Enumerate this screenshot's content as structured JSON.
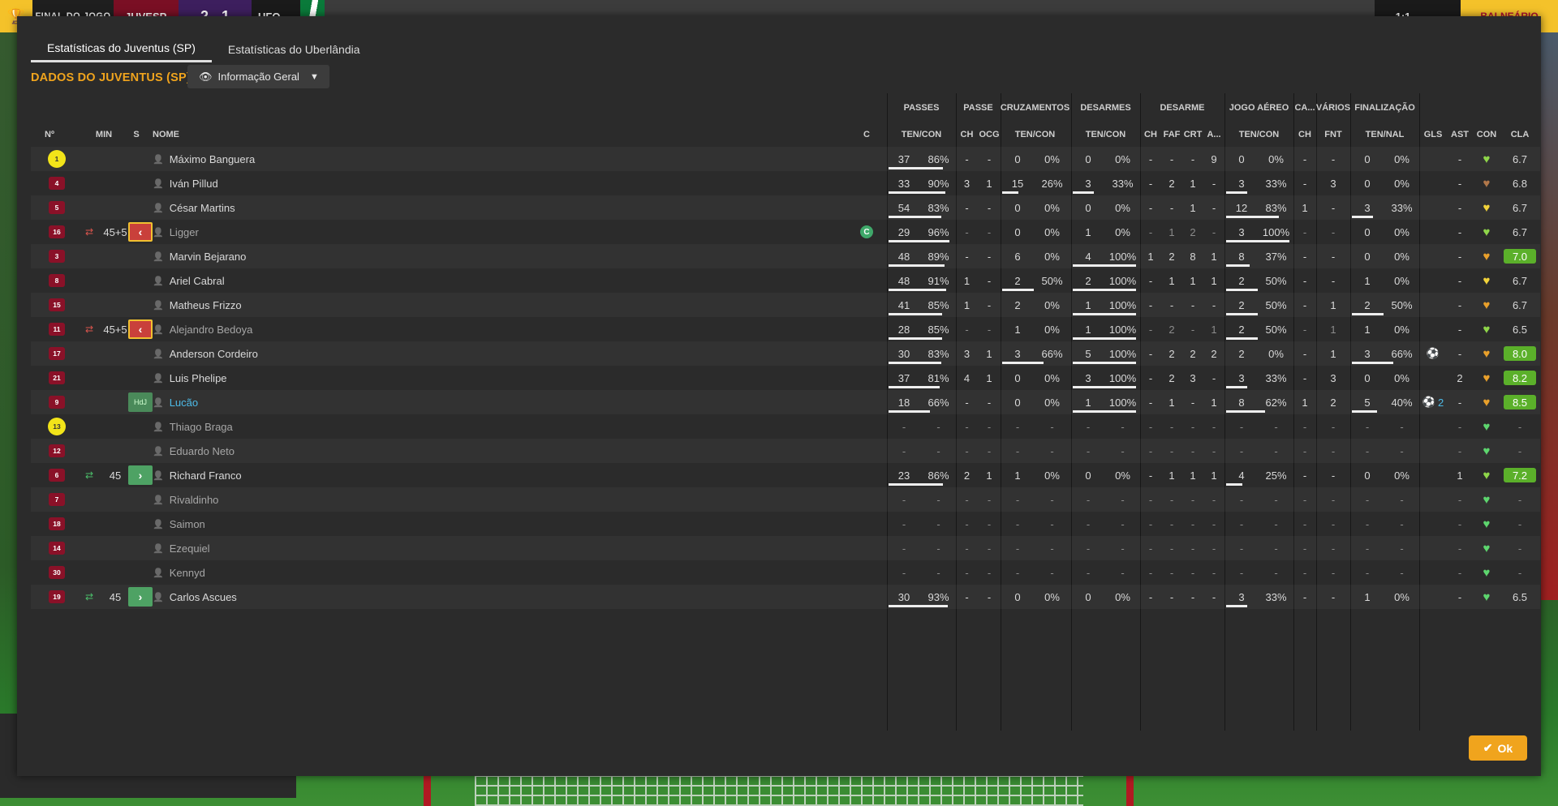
{
  "topbar": {
    "result_label": "FINAL DO JOGO",
    "home_team": "JUVESP",
    "score": "2 - 1",
    "away_team": "UFO",
    "clock": "1:1",
    "right_button": "BALNEÁRIO"
  },
  "dialog": {
    "tabs": [
      "Estatísticas do Juventus (SP)",
      "Estatísticas do Uberlândia"
    ],
    "heading": "DADOS DO JUVENTUS (SP)",
    "view_select": "Informação Geral",
    "ok_label": "Ok"
  },
  "groups": [
    "PASSES",
    "PASSE",
    "CRUZAMENTOS",
    "DESARMES",
    "DESARME",
    "JOGO AÉREO",
    "CA...",
    "VÁRIOS",
    "FINALIZAÇÃO"
  ],
  "headers": [
    "Nº",
    "MIN",
    "S",
    "NOME",
    "C",
    "TEN/CON",
    "CH",
    "OCG",
    "TEN/CON",
    "TEN/CON",
    "CH",
    "FAF",
    "CRT",
    "A...",
    "TEN/CON",
    "CH",
    "FNT",
    "TEN/NAL",
    "GLS",
    "AST",
    "CON",
    "CLA"
  ],
  "colors": {
    "accent": "#f0a41d",
    "shirt": "#8a1128",
    "keeper_shirt": "#f2e419",
    "sub_out": "#c9403b",
    "sub_in": "#4ea264",
    "rating_high": "#5bb02a",
    "highlight_name": "#4dbbe8"
  },
  "players": [
    {
      "num": "1",
      "gk": true,
      "min": "",
      "sub": "",
      "name": "Máximo Banguera",
      "dim": false,
      "cap": false,
      "pass_att": "37",
      "pass_pct": "86%",
      "pass_frac": 0.86,
      "kp": "-",
      "ocg": "-",
      "cr_att": "0",
      "cr_pct": "0%",
      "cr_frac": 0,
      "tk_att": "0",
      "tk_pct": "0%",
      "tk_frac": 0,
      "d_ch": "-",
      "d_faf": "-",
      "d_crt": "-",
      "d_a": "9",
      "air_att": "0",
      "air_pct": "0%",
      "air_frac": 0,
      "ca_ch": "-",
      "fnt": "-",
      "sh_att": "0",
      "sh_pct": "0%",
      "sh_frac": 0,
      "gls": "",
      "ast": "-",
      "con": "lime",
      "cla": "6.7",
      "cla_hi": false
    },
    {
      "num": "4",
      "gk": false,
      "min": "",
      "sub": "",
      "name": "Iván Pillud",
      "dim": false,
      "cap": false,
      "pass_att": "33",
      "pass_pct": "90%",
      "pass_frac": 0.9,
      "kp": "3",
      "ocg": "1",
      "cr_att": "15",
      "cr_pct": "26%",
      "cr_frac": 0.26,
      "tk_att": "3",
      "tk_pct": "33%",
      "tk_frac": 0.33,
      "d_ch": "-",
      "d_faf": "2",
      "d_crt": "1",
      "d_a": "-",
      "air_att": "3",
      "air_pct": "33%",
      "air_frac": 0.33,
      "ca_ch": "-",
      "fnt": "3",
      "sh_att": "0",
      "sh_pct": "0%",
      "sh_frac": 0,
      "gls": "",
      "ast": "-",
      "con": "brown",
      "cla": "6.8",
      "cla_hi": false
    },
    {
      "num": "5",
      "gk": false,
      "min": "",
      "sub": "",
      "name": "César Martins",
      "dim": false,
      "cap": false,
      "pass_att": "54",
      "pass_pct": "83%",
      "pass_frac": 0.83,
      "kp": "-",
      "ocg": "-",
      "cr_att": "0",
      "cr_pct": "0%",
      "cr_frac": 0,
      "tk_att": "0",
      "tk_pct": "0%",
      "tk_frac": 0,
      "d_ch": "-",
      "d_faf": "-",
      "d_crt": "1",
      "d_a": "-",
      "air_att": "12",
      "air_pct": "83%",
      "air_frac": 0.83,
      "ca_ch": "1",
      "fnt": "-",
      "sh_att": "3",
      "sh_pct": "33%",
      "sh_frac": 0.33,
      "gls": "",
      "ast": "-",
      "con": "yellow",
      "cla": "6.7",
      "cla_hi": false
    },
    {
      "num": "16",
      "gk": false,
      "min": "45+5",
      "sub": "out",
      "name": "Ligger",
      "dim": true,
      "cap": true,
      "pass_att": "29",
      "pass_pct": "96%",
      "pass_frac": 0.96,
      "kp": "-",
      "ocg": "-",
      "cr_att": "0",
      "cr_pct": "0%",
      "cr_frac": 0,
      "tk_att": "1",
      "tk_pct": "0%",
      "tk_frac": 0,
      "d_ch": "-",
      "d_faf": "1",
      "d_crt": "2",
      "d_a": "-",
      "air_att": "3",
      "air_pct": "100%",
      "air_frac": 1,
      "ca_ch": "-",
      "fnt": "-",
      "sh_att": "0",
      "sh_pct": "0%",
      "sh_frac": 0,
      "gls": "",
      "ast": "-",
      "con": "lime",
      "cla": "6.7",
      "cla_hi": false
    },
    {
      "num": "3",
      "gk": false,
      "min": "",
      "sub": "",
      "name": "Marvin Bejarano",
      "dim": false,
      "cap": false,
      "pass_att": "48",
      "pass_pct": "89%",
      "pass_frac": 0.89,
      "kp": "-",
      "ocg": "-",
      "cr_att": "6",
      "cr_pct": "0%",
      "cr_frac": 0,
      "tk_att": "4",
      "tk_pct": "100%",
      "tk_frac": 1,
      "d_ch": "1",
      "d_faf": "2",
      "d_crt": "8",
      "d_a": "1",
      "air_att": "8",
      "air_pct": "37%",
      "air_frac": 0.37,
      "ca_ch": "-",
      "fnt": "-",
      "sh_att": "0",
      "sh_pct": "0%",
      "sh_frac": 0,
      "gls": "",
      "ast": "-",
      "con": "orange",
      "cla": "7.0",
      "cla_hi": true
    },
    {
      "num": "8",
      "gk": false,
      "min": "",
      "sub": "",
      "name": "Ariel Cabral",
      "dim": false,
      "cap": false,
      "pass_att": "48",
      "pass_pct": "91%",
      "pass_frac": 0.91,
      "kp": "1",
      "ocg": "-",
      "cr_att": "2",
      "cr_pct": "50%",
      "cr_frac": 0.5,
      "tk_att": "2",
      "tk_pct": "100%",
      "tk_frac": 1,
      "d_ch": "-",
      "d_faf": "1",
      "d_crt": "1",
      "d_a": "1",
      "air_att": "2",
      "air_pct": "50%",
      "air_frac": 0.5,
      "ca_ch": "-",
      "fnt": "-",
      "sh_att": "1",
      "sh_pct": "0%",
      "sh_frac": 0,
      "gls": "",
      "ast": "-",
      "con": "yellow",
      "cla": "6.7",
      "cla_hi": false
    },
    {
      "num": "15",
      "gk": false,
      "min": "",
      "sub": "",
      "name": "Matheus Frizzo",
      "dim": false,
      "cap": false,
      "pass_att": "41",
      "pass_pct": "85%",
      "pass_frac": 0.85,
      "kp": "1",
      "ocg": "-",
      "cr_att": "2",
      "cr_pct": "0%",
      "cr_frac": 0,
      "tk_att": "1",
      "tk_pct": "100%",
      "tk_frac": 1,
      "d_ch": "-",
      "d_faf": "-",
      "d_crt": "-",
      "d_a": "-",
      "air_att": "2",
      "air_pct": "50%",
      "air_frac": 0.5,
      "ca_ch": "-",
      "fnt": "1",
      "sh_att": "2",
      "sh_pct": "50%",
      "sh_frac": 0.5,
      "gls": "",
      "ast": "-",
      "con": "orange",
      "cla": "6.7",
      "cla_hi": false
    },
    {
      "num": "11",
      "gk": false,
      "min": "45+5",
      "sub": "out",
      "name": "Alejandro Bedoya",
      "dim": true,
      "cap": false,
      "pass_att": "28",
      "pass_pct": "85%",
      "pass_frac": 0.85,
      "kp": "-",
      "ocg": "-",
      "cr_att": "1",
      "cr_pct": "0%",
      "cr_frac": 0,
      "tk_att": "1",
      "tk_pct": "100%",
      "tk_frac": 1,
      "d_ch": "-",
      "d_faf": "2",
      "d_crt": "-",
      "d_a": "1",
      "air_att": "2",
      "air_pct": "50%",
      "air_frac": 0.5,
      "ca_ch": "-",
      "fnt": "1",
      "sh_att": "1",
      "sh_pct": "0%",
      "sh_frac": 0,
      "gls": "",
      "ast": "-",
      "con": "lime",
      "cla": "6.5",
      "cla_hi": false
    },
    {
      "num": "17",
      "gk": false,
      "min": "",
      "sub": "",
      "name": "Anderson Cordeiro",
      "dim": false,
      "cap": false,
      "pass_att": "30",
      "pass_pct": "83%",
      "pass_frac": 0.83,
      "kp": "3",
      "ocg": "1",
      "cr_att": "3",
      "cr_pct": "66%",
      "cr_frac": 0.66,
      "tk_att": "5",
      "tk_pct": "100%",
      "tk_frac": 1,
      "d_ch": "-",
      "d_faf": "2",
      "d_crt": "2",
      "d_a": "2",
      "air_att": "2",
      "air_pct": "0%",
      "air_frac": 0,
      "ca_ch": "-",
      "fnt": "1",
      "sh_att": "3",
      "sh_pct": "66%",
      "sh_frac": 0.66,
      "gls": "ball",
      "ast": "-",
      "con": "orange",
      "cla": "8.0",
      "cla_hi": true
    },
    {
      "num": "21",
      "gk": false,
      "min": "",
      "sub": "",
      "name": "Luis Phelipe",
      "dim": false,
      "cap": false,
      "pass_att": "37",
      "pass_pct": "81%",
      "pass_frac": 0.81,
      "kp": "4",
      "ocg": "1",
      "cr_att": "0",
      "cr_pct": "0%",
      "cr_frac": 0,
      "tk_att": "3",
      "tk_pct": "100%",
      "tk_frac": 1,
      "d_ch": "-",
      "d_faf": "2",
      "d_crt": "3",
      "d_a": "-",
      "air_att": "3",
      "air_pct": "33%",
      "air_frac": 0.33,
      "ca_ch": "-",
      "fnt": "3",
      "sh_att": "0",
      "sh_pct": "0%",
      "sh_frac": 0,
      "gls": "",
      "ast": "2",
      "con": "orange",
      "cla": "8.2",
      "cla_hi": true
    },
    {
      "num": "9",
      "gk": false,
      "min": "",
      "sub": "hdj",
      "sub_label": "HdJ",
      "name": "Lucão",
      "dim": false,
      "hl": true,
      "cap": false,
      "pass_att": "18",
      "pass_pct": "66%",
      "pass_frac": 0.66,
      "kp": "-",
      "ocg": "-",
      "cr_att": "0",
      "cr_pct": "0%",
      "cr_frac": 0,
      "tk_att": "1",
      "tk_pct": "100%",
      "tk_frac": 1,
      "d_ch": "-",
      "d_faf": "1",
      "d_crt": "-",
      "d_a": "1",
      "air_att": "8",
      "air_pct": "62%",
      "air_frac": 0.62,
      "ca_ch": "1",
      "fnt": "2",
      "sh_att": "5",
      "sh_pct": "40%",
      "sh_frac": 0.4,
      "gls": "ball2",
      "gls_num": "2",
      "ast": "-",
      "con": "orange",
      "cla": "8.5",
      "cla_hi": true
    },
    {
      "num": "13",
      "gk": true,
      "min": "",
      "sub": "",
      "name": "Thiago Braga",
      "dim": true,
      "cap": false,
      "empty": true,
      "con": "green",
      "cla": "-",
      "cla_hi": false
    },
    {
      "num": "12",
      "gk": false,
      "min": "",
      "sub": "",
      "name": "Eduardo Neto",
      "dim": true,
      "cap": false,
      "empty": true,
      "con": "green",
      "cla": "-",
      "cla_hi": false
    },
    {
      "num": "6",
      "gk": false,
      "min": "45",
      "sub": "in",
      "name": "Richard Franco",
      "dim": false,
      "cap": false,
      "pass_att": "23",
      "pass_pct": "86%",
      "pass_frac": 0.86,
      "kp": "2",
      "ocg": "1",
      "cr_att": "1",
      "cr_pct": "0%",
      "cr_frac": 0,
      "tk_att": "0",
      "tk_pct": "0%",
      "tk_frac": 0,
      "d_ch": "-",
      "d_faf": "1",
      "d_crt": "1",
      "d_a": "1",
      "air_att": "4",
      "air_pct": "25%",
      "air_frac": 0.25,
      "ca_ch": "-",
      "fnt": "-",
      "sh_att": "0",
      "sh_pct": "0%",
      "sh_frac": 0,
      "gls": "",
      "ast": "1",
      "con": "lime",
      "cla": "7.2",
      "cla_hi": true
    },
    {
      "num": "7",
      "gk": false,
      "min": "",
      "sub": "",
      "name": "Rivaldinho",
      "dim": true,
      "cap": false,
      "empty": true,
      "con": "green",
      "cla": "-",
      "cla_hi": false
    },
    {
      "num": "18",
      "gk": false,
      "min": "",
      "sub": "",
      "name": "Saimon",
      "dim": true,
      "cap": false,
      "empty": true,
      "con": "green",
      "cla": "-",
      "cla_hi": false
    },
    {
      "num": "14",
      "gk": false,
      "min": "",
      "sub": "",
      "name": "Ezequiel",
      "dim": true,
      "cap": false,
      "empty": true,
      "con": "green",
      "cla": "-",
      "cla_hi": false
    },
    {
      "num": "30",
      "gk": false,
      "min": "",
      "sub": "",
      "name": "Kennyd",
      "dim": true,
      "cap": false,
      "empty": true,
      "con": "green",
      "cla": "-",
      "cla_hi": false
    },
    {
      "num": "19",
      "gk": false,
      "min": "45",
      "sub": "in",
      "name": "Carlos Ascues",
      "dim": false,
      "cap": false,
      "pass_att": "30",
      "pass_pct": "93%",
      "pass_frac": 0.93,
      "kp": "-",
      "ocg": "-",
      "cr_att": "0",
      "cr_pct": "0%",
      "cr_frac": 0,
      "tk_att": "0",
      "tk_pct": "0%",
      "tk_frac": 0,
      "d_ch": "-",
      "d_faf": "-",
      "d_crt": "-",
      "d_a": "-",
      "air_att": "3",
      "air_pct": "33%",
      "air_frac": 0.33,
      "ca_ch": "-",
      "fnt": "-",
      "sh_att": "1",
      "sh_pct": "0%",
      "sh_frac": 0,
      "gls": "",
      "ast": "-",
      "con": "green",
      "cla": "6.5",
      "cla_hi": false
    }
  ]
}
